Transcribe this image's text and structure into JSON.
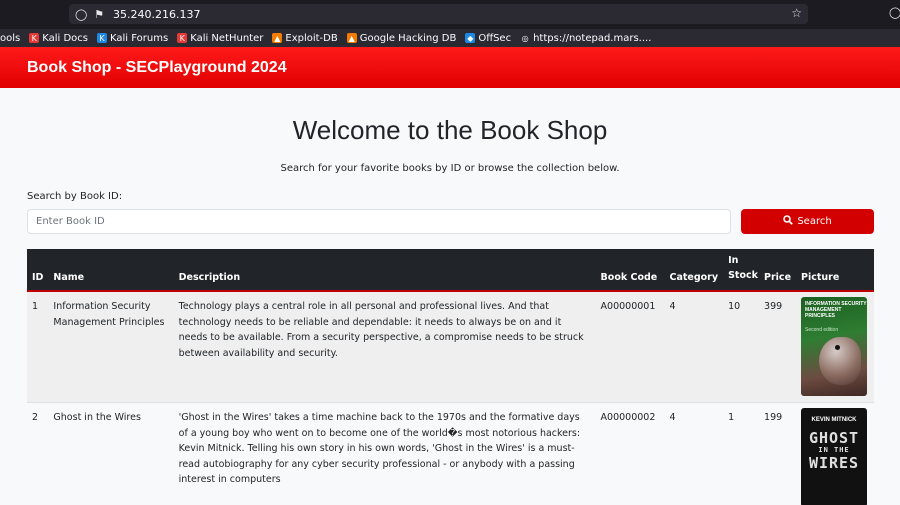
{
  "browser": {
    "url": "35.240.216.137",
    "bookmarks": [
      {
        "label": "ools",
        "icon": "none",
        "color": ""
      },
      {
        "label": "Kali Docs",
        "icon": "kali-docs-icon",
        "color": "#e53935"
      },
      {
        "label": "Kali Forums",
        "icon": "kali-forums-icon",
        "color": "#1e88e5"
      },
      {
        "label": "Kali NetHunter",
        "icon": "kali-nethunter-icon",
        "color": "#e53935"
      },
      {
        "label": "Exploit-DB",
        "icon": "exploit-db-icon",
        "color": "#f57c00"
      },
      {
        "label": "Google Hacking DB",
        "icon": "google-hacking-db-icon",
        "color": "#f57c00"
      },
      {
        "label": "OffSec",
        "icon": "offsec-icon",
        "color": "#1e88e5"
      },
      {
        "label": "https://notepad.mars....",
        "icon": "globe-icon",
        "color": ""
      }
    ]
  },
  "header": {
    "brand": "Book Shop - SECPlayground 2024"
  },
  "main": {
    "title": "Welcome to the Book Shop",
    "subtitle": "Search for your favorite books by ID or browse the collection below.",
    "search_label": "Search by Book ID:",
    "search_placeholder": "Enter Book ID",
    "search_button": "Search"
  },
  "table": {
    "headers": {
      "id": "ID",
      "name": "Name",
      "description": "Description",
      "code": "Book Code",
      "category": "Category",
      "stock": "In Stock",
      "price": "Price",
      "picture": "Picture"
    },
    "rows": [
      {
        "id": "1",
        "name": "Information Security Management Principles",
        "description": "Technology plays a central role in all personal and professional lives. And that technology needs to be reliable and dependable: it needs to always be on and it needs to be available. From a security perspective, a compromise needs to be struck between availability and security.",
        "code": "A00000001",
        "category": "4",
        "stock": "10",
        "price": "399",
        "cover_title": "INFORMATION SECURITY MANAGEMENT PRINCIPLES",
        "cover_subtitle": "Second edition"
      },
      {
        "id": "2",
        "name": "Ghost in the Wires",
        "description": "'Ghost in the Wires' takes a time machine back to the 1970s and the formative days of a young boy who went on to become one of the world�s most notorious hackers: Kevin Mitnick. Telling his own story in his own words, 'Ghost in the Wires' is a must-read autobiography for any cyber security professional - or anybody with a passing interest in computers",
        "code": "A00000002",
        "category": "4",
        "stock": "1",
        "price": "199",
        "cover_author": "KEVIN MITNICK",
        "cover_title_1": "GHOST",
        "cover_title_2": "IN THE",
        "cover_title_3": "WIRES"
      }
    ]
  }
}
